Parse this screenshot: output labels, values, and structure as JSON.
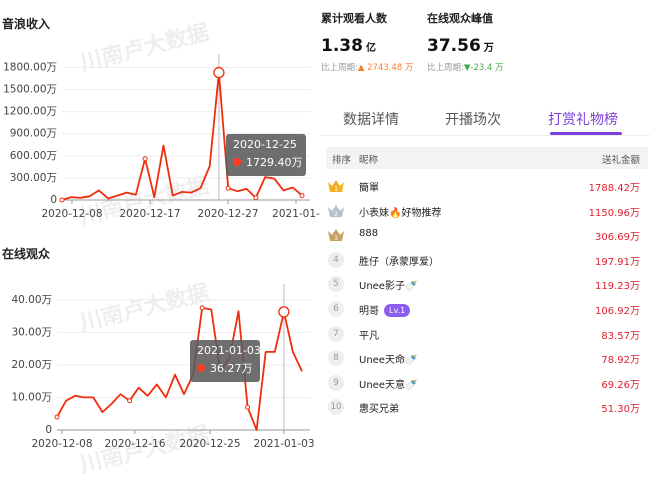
{
  "colors": {
    "line": "#f02d0a",
    "accent": "#7b3fd9",
    "amount": "#e02030",
    "up": "#ff7a2a",
    "down": "#3fae45"
  },
  "watermark": "川南卢大数据",
  "stats": [
    {
      "label": "累计观看人数",
      "value": "1.38",
      "unit": "亿",
      "cmp_prefix": "比上周期:",
      "cmp_arrow": "▲",
      "cmp_value": "2743.48 万",
      "trend": "up"
    },
    {
      "label": "在线观众峰值",
      "value": "37.56",
      "unit": "万",
      "cmp_prefix": "比上周期:",
      "cmp_arrow": "▼",
      "cmp_value": "-23.4 万",
      "trend": "down"
    }
  ],
  "tabs": [
    {
      "label": "数据详情",
      "active": false
    },
    {
      "label": "开播场次",
      "active": false
    },
    {
      "label": "打赏礼物榜",
      "active": true
    }
  ],
  "table": {
    "headers": {
      "rank": "排序",
      "name": "昵称",
      "amount": "送礼金额"
    },
    "rows": [
      {
        "rank": "1",
        "name": "簡單",
        "badge": "",
        "amount": "1788.42万",
        "icon": "gold-crown-icon"
      },
      {
        "rank": "2",
        "name": "小表妹🔥好物推荐",
        "badge": "",
        "amount": "1150.96万",
        "icon": "silver-crown-icon"
      },
      {
        "rank": "3",
        "name": "888",
        "badge": "",
        "amount": "306.69万",
        "icon": "bronze-crown-icon"
      },
      {
        "rank": "4",
        "name": "胜仔（承蒙厚爱）",
        "badge": "",
        "amount": "197.91万",
        "icon": ""
      },
      {
        "rank": "5",
        "name": "Unee影子🍼",
        "badge": "",
        "amount": "119.23万",
        "icon": ""
      },
      {
        "rank": "6",
        "name": "明哥",
        "badge": "Lv.1",
        "amount": "106.92万",
        "icon": ""
      },
      {
        "rank": "7",
        "name": "平凡",
        "badge": "",
        "amount": "83.57万",
        "icon": ""
      },
      {
        "rank": "8",
        "name": "Unee天命🍼",
        "badge": "",
        "amount": "78.92万",
        "icon": ""
      },
      {
        "rank": "9",
        "name": "Unee天意🍼",
        "badge": "",
        "amount": "69.26万",
        "icon": ""
      },
      {
        "rank": "10",
        "name": "惠买兄弟",
        "badge": "",
        "amount": "51.30万",
        "icon": ""
      }
    ]
  },
  "chart_data": [
    {
      "type": "line",
      "title": "音浪收入",
      "xlabel": "",
      "ylabel": "",
      "ylim": [
        0,
        1900
      ],
      "y_ticks": [
        0,
        300,
        600,
        900,
        1200,
        1500,
        1800
      ],
      "y_tick_labels": [
        "0",
        "300.00万",
        "600.00万",
        "900.00万",
        "1200.00万",
        "1500.00万",
        "1800.00万"
      ],
      "x_ticks": [
        0,
        9,
        19,
        29,
        34
      ],
      "x_tick_labels": [
        "2020-12-08",
        "2020-12-17",
        "2020-12-27",
        "2021-01-"
      ],
      "series": [
        {
          "values": [
            0,
            40,
            30,
            50,
            130,
            20,
            60,
            100,
            70,
            560,
            40,
            740,
            60,
            110,
            100,
            160,
            460,
            1729.4,
            160,
            120,
            150,
            30,
            310,
            290,
            130,
            170,
            60
          ]
        }
      ],
      "highlight": {
        "index": 17,
        "date": "2020-12-25",
        "value_label": "1729.40万"
      }
    },
    {
      "type": "line",
      "title": "在线观众",
      "xlabel": "",
      "ylabel": "",
      "ylim": [
        0,
        43
      ],
      "y_ticks": [
        0,
        10,
        20,
        30,
        40
      ],
      "y_tick_labels": [
        "0",
        "10.00万",
        "20.00万",
        "30.00万",
        "40.00万"
      ],
      "x_tick_labels": [
        "2020-12-08",
        "2020-12-16",
        "2020-12-25",
        "2021-01-03"
      ],
      "series": [
        {
          "values": [
            4,
            9,
            10.5,
            10,
            10,
            5.5,
            8,
            11,
            9,
            13,
            10.5,
            14,
            10,
            17,
            11,
            17,
            37.5,
            37,
            18,
            22,
            36.5,
            7,
            0,
            24,
            24,
            36.27,
            24,
            18
          ]
        }
      ],
      "highlight": {
        "index": 25,
        "date": "2021-01-03",
        "value_label": "36.27万"
      }
    }
  ]
}
